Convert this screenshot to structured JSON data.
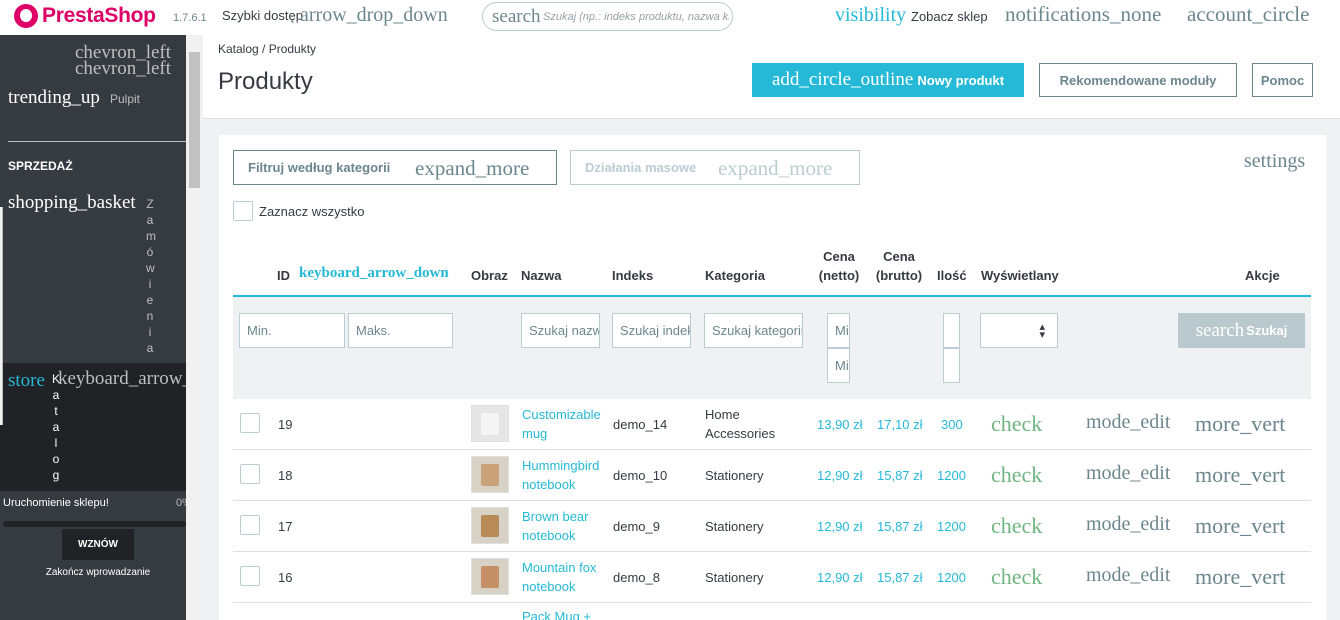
{
  "header": {
    "logo_text": "PrestaShop",
    "version": "1.7.6.1",
    "quick_access": "Szybki dostęp",
    "quick_access_icon": "arrow_drop_down",
    "search_icon": "search",
    "search_placeholder": "Szukaj (np.: indeks produktu, nazwa klienta...)",
    "visibility_icon": "visibility",
    "view_shop": "Zobacz sklep",
    "notifications_icon": "notifications_none",
    "account_icon": "account_circle"
  },
  "sidebar": {
    "collapse_icon_1": "chevron_left",
    "collapse_icon_2": "chevron_left",
    "dashboard_icon": "trending_up",
    "dashboard_label": "Pulpit",
    "section_sell": "SPRZEDAŻ",
    "orders_icon": "shopping_basket",
    "orders_label": "Zamówienia",
    "catalog_icon": "store",
    "catalog_label": "Katalog",
    "catalog_arrow": "keyboard_arrow_down",
    "onboarding_text": "Uruchomienie sklepu!",
    "onboarding_percent": "0%",
    "onboarding_progress": 0,
    "resume_button": "WZNÓW",
    "end_onboarding": "Zakończ wprowadzanie"
  },
  "page": {
    "breadcrumb": "Katalog / Produkty",
    "title": "Produkty",
    "new_product_icon": "add_circle_outline",
    "new_product_label": "Nowy produkt",
    "recommended_modules": "Rekomendowane moduły",
    "help": "Pomoc"
  },
  "toolbar": {
    "filter_category": "Filtruj według kategorii",
    "filter_category_icon": "expand_more",
    "bulk_actions": "Działania masowe",
    "bulk_actions_icon": "expand_more",
    "settings_icon": "settings",
    "select_all": "Zaznacz wszystko"
  },
  "table": {
    "headers": {
      "id": "ID",
      "id_sort_icon": "keyboard_arrow_down",
      "image": "Obraz",
      "name": "Nazwa",
      "reference": "Indeks",
      "category": "Kategoria",
      "price_net_1": "Cena",
      "price_net_2": "(netto)",
      "price_gross_1": "Cena",
      "price_gross_2": "(brutto)",
      "quantity": "Ilość",
      "status": "Wyświetlany",
      "actions": "Akcje"
    },
    "filters": {
      "id_min": "Min.",
      "id_max": "Maks.",
      "name": "Szukaj nazwy",
      "reference": "Szukaj indeksu",
      "category": "Szukaj kategorii",
      "price_min": "Min.",
      "price_max": "Min.",
      "search_icon": "search",
      "search_label": "Szukaj"
    },
    "rows": [
      {
        "id": "19",
        "name_1": "Customizable",
        "name_2": "mug",
        "reference": "demo_14",
        "category_1": "Home",
        "category_2": "Accessories",
        "price_net": "13,90 zł",
        "price_gross": "17,10 zł",
        "quantity": "300",
        "status_icon": "check",
        "edit_icon": "mode_edit",
        "more_icon": "more_vert",
        "thumb_color": "#e6e6e6",
        "thumb_mark": "#f4f4f4"
      },
      {
        "id": "18",
        "name_1": "Hummingbird",
        "name_2": "notebook",
        "reference": "demo_10",
        "category_1": "Stationery",
        "category_2": "",
        "price_net": "12,90 zł",
        "price_gross": "15,87 zł",
        "quantity": "1200",
        "status_icon": "check",
        "edit_icon": "mode_edit",
        "more_icon": "more_vert",
        "thumb_color": "#d8d1c6",
        "thumb_mark": "#c9a27a"
      },
      {
        "id": "17",
        "name_1": "Brown bear",
        "name_2": "notebook",
        "reference": "demo_9",
        "category_1": "Stationery",
        "category_2": "",
        "price_net": "12,90 zł",
        "price_gross": "15,87 zł",
        "quantity": "1200",
        "status_icon": "check",
        "edit_icon": "mode_edit",
        "more_icon": "more_vert",
        "thumb_color": "#d8d1c6",
        "thumb_mark": "#b98a58"
      },
      {
        "id": "16",
        "name_1": "Mountain fox",
        "name_2": "notebook",
        "reference": "demo_8",
        "category_1": "Stationery",
        "category_2": "",
        "price_net": "12,90 zł",
        "price_gross": "15,87 zł",
        "quantity": "1200",
        "status_icon": "check",
        "edit_icon": "mode_edit",
        "more_icon": "more_vert",
        "thumb_color": "#d8d1c6",
        "thumb_mark": "#c59066"
      }
    ],
    "partial_row_name": "Pack Mug +"
  }
}
